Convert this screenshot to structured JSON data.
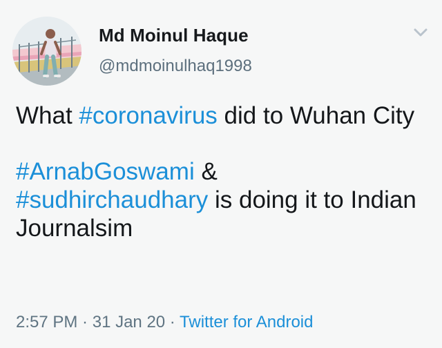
{
  "tweet": {
    "author": {
      "name": "Md Moinul Haque",
      "handle": "@mdmoinulhaq1998"
    },
    "text": {
      "line1_prefix": "What ",
      "hashtag_coronavirus": "#coronavirus",
      "line1_suffix": " did to Wuhan City",
      "hashtag_arnab": "#ArnabGoswami",
      "after_arnab": " &",
      "hashtag_sudhir": "#sudhirchaudhary",
      "after_sudhir": " is doing it to Indian Journalsim"
    },
    "meta": {
      "time": "2:57 PM",
      "separator1": " · ",
      "date": "31 Jan 20",
      "separator2": " · ",
      "source": "Twitter for Android"
    }
  },
  "icons": {
    "menu": "chevron-down-icon"
  },
  "colors": {
    "link": "#1b8fd8",
    "text": "#14171a",
    "secondary": "#5f7482",
    "background": "#f6f7f7"
  }
}
